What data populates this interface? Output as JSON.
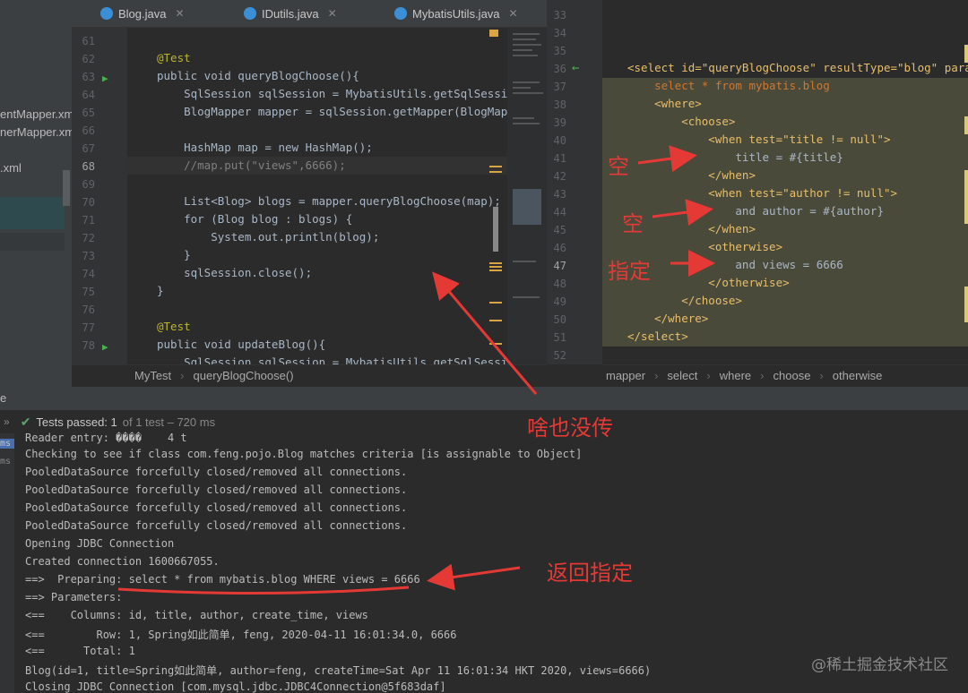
{
  "project": {
    "items": [
      "entMapper.xml",
      "nerMapper.xml",
      ".xml"
    ]
  },
  "tabs": [
    {
      "label": "Blog.java"
    },
    {
      "label": "IDutils.java"
    },
    {
      "label": "MybatisUtils.java"
    }
  ],
  "editor": {
    "line_numbers": [
      "61",
      "62",
      "63",
      "64",
      "65",
      "66",
      "67",
      "68",
      "69",
      "70",
      "71",
      "72",
      "73",
      "74",
      "75",
      "76",
      "77",
      "78"
    ],
    "lines": [
      "",
      "@Test",
      "public void queryBlogChoose(){",
      "    SqlSession sqlSession = MybatisUtils.getSqlSession(",
      "    BlogMapper mapper = sqlSession.getMapper(BlogMapper",
      "",
      "    HashMap map = new HashMap();",
      "    //map.put(\"views\",6666);",
      "",
      "    List<Blog> blogs = mapper.queryBlogChoose(map);",
      "    for (Blog blog : blogs) {",
      "        System.out.println(blog);",
      "    }",
      "    sqlSession.close();",
      "}",
      "",
      "@Test",
      "public void updateBlog(){",
      "    SqlSession sqlSession = MybatisUtils.getSqlSession("
    ]
  },
  "editor_breadcrumb": [
    "MyTest",
    "queryBlogChoose()"
  ],
  "xml": {
    "line_numbers": [
      "33",
      "34",
      "35",
      "36",
      "37",
      "38",
      "39",
      "40",
      "41",
      "42",
      "43",
      "44",
      "45",
      "46",
      "47",
      "48",
      "49",
      "50",
      "51",
      "52"
    ],
    "lines": [
      "",
      "",
      "",
      "<select id=\"queryBlogChoose\" resultType=\"blog\" paramete",
      "    select * from mybatis.blog",
      "    <where>",
      "        <choose>",
      "            <when test=\"title != null\">",
      "                title = #{title}",
      "            </when>",
      "            <when test=\"author != null\">",
      "                and author = #{author}",
      "            </when>",
      "            <otherwise>",
      "                and views = 6666",
      "            </otherwise>",
      "        </choose>",
      "    </where>",
      "</select>",
      ""
    ]
  },
  "xml_breadcrumb": [
    "mapper",
    "select",
    "where",
    "choose",
    "otherwise"
  ],
  "console": {
    "tab_label": "e",
    "tests_passed": "Tests passed: 1",
    "tests_detail": "of 1 test – 720 ms",
    "side_labels": [
      "ms",
      "ms"
    ],
    "lines": [
      "Reader entry: ����    4 t",
      "Checking to see if class com.feng.pojo.Blog matches criteria [is assignable to Object]",
      "PooledDataSource forcefully closed/removed all connections.",
      "PooledDataSource forcefully closed/removed all connections.",
      "PooledDataSource forcefully closed/removed all connections.",
      "PooledDataSource forcefully closed/removed all connections.",
      "Opening JDBC Connection",
      "Created connection 1600667055.",
      "==>  Preparing: select * from mybatis.blog WHERE views = 6666",
      "==> Parameters: ",
      "<==    Columns: id, title, author, create_time, views",
      "<==        Row: 1, Spring如此简单, feng, 2020-04-11 16:01:34.0, 6666",
      "<==      Total: 1",
      "Blog(id=1, title=Spring如此简单, author=feng, createTime=Sat Apr 11 16:01:34 HKT 2020, views=6666)",
      "Closing JDBC Connection [com.mysql.jdbc.JDBC4Connection@5f683daf]"
    ]
  },
  "annotations": {
    "empty1": "空",
    "empty2": "空",
    "specified": "指定",
    "nothing_passed": "啥也没传",
    "return_specified": "返回指定"
  },
  "watermark": "@稀土掘金技术社区",
  "colors": {
    "annotation": "#e53935",
    "highlight": "#4a4a3a"
  }
}
